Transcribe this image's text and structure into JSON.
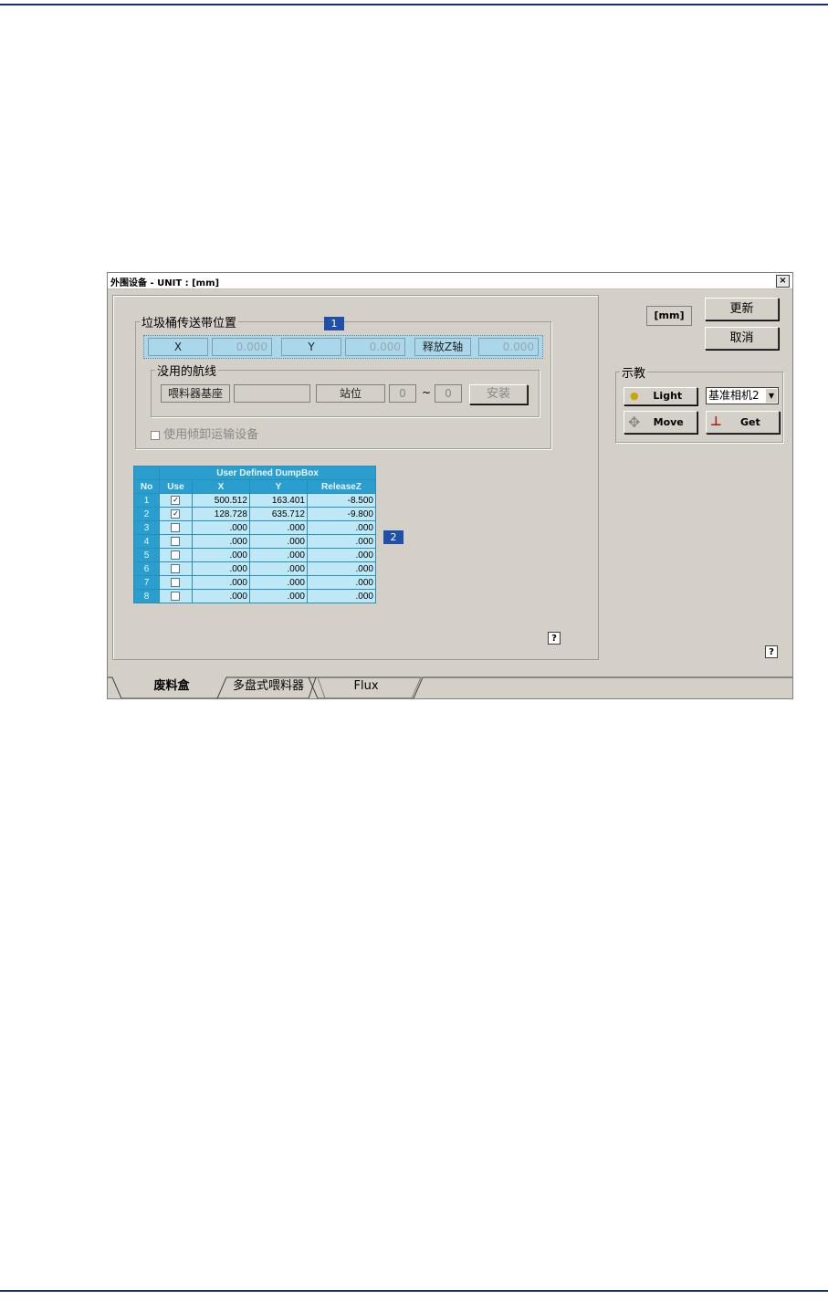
{
  "window": {
    "title": "外围设备 - UNIT : [mm]",
    "close_glyph": "×"
  },
  "belt_group": {
    "label": "垃圾桶传送带位置",
    "x_label": "X",
    "x_value": "0.000",
    "y_label": "Y",
    "y_value": "0.000",
    "z_label": "释放Z轴",
    "z_value": "0.000"
  },
  "route_group": {
    "label": "没用的航线",
    "feeder_base_label": "喂料器基座",
    "feeder_base_value": "",
    "station_label": "站位",
    "station_from": "0",
    "station_sep": "~",
    "station_to": "0",
    "install_label": "安装"
  },
  "use_tilt": {
    "label": "使用倾卸运输设备"
  },
  "markers": {
    "one": "1",
    "two": "2"
  },
  "dumpbox": {
    "title": "User Defined DumpBox",
    "headers": [
      "No",
      "Use",
      "X",
      "Y",
      "ReleaseZ"
    ],
    "rows": [
      {
        "no": "1",
        "use": true,
        "x": "500.512",
        "y": "163.401",
        "z": "-8.500"
      },
      {
        "no": "2",
        "use": true,
        "x": "128.728",
        "y": "635.712",
        "z": "-9.800"
      },
      {
        "no": "3",
        "use": false,
        "x": ".000",
        "y": ".000",
        "z": ".000"
      },
      {
        "no": "4",
        "use": false,
        "x": ".000",
        "y": ".000",
        "z": ".000"
      },
      {
        "no": "5",
        "use": false,
        "x": ".000",
        "y": ".000",
        "z": ".000"
      },
      {
        "no": "6",
        "use": false,
        "x": ".000",
        "y": ".000",
        "z": ".000"
      },
      {
        "no": "7",
        "use": false,
        "x": ".000",
        "y": ".000",
        "z": ".000"
      },
      {
        "no": "8",
        "use": false,
        "x": ".000",
        "y": ".000",
        "z": ".000"
      }
    ]
  },
  "right_panel": {
    "unit_label": "[mm]",
    "update_label": "更新",
    "cancel_label": "取消",
    "teach_label": "示教",
    "light_label": "Light",
    "camera_select": "基准相机2",
    "move_label": "Move",
    "get_label": "Get"
  },
  "help_glyph": "?",
  "tabs": [
    "废料盒",
    "多盘式喂料器",
    "Flux"
  ]
}
